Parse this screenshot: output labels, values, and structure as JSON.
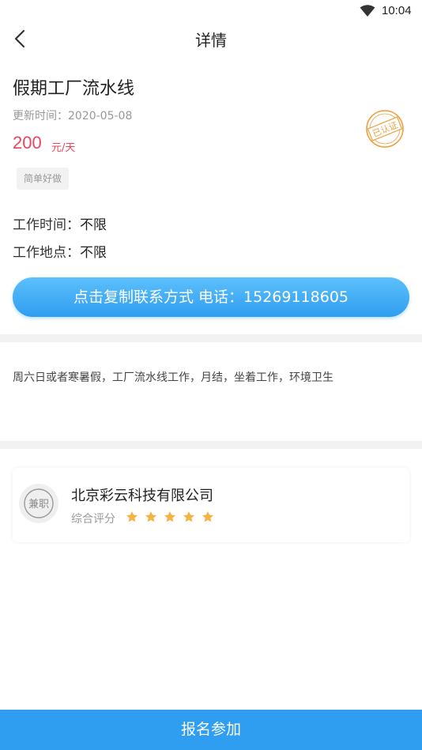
{
  "status_bar": {
    "time": "10:04"
  },
  "nav": {
    "title": "详情"
  },
  "job": {
    "title": "假期工厂流水线",
    "update_time": "更新时间：2020-05-08",
    "salary_amount": "200",
    "salary_unit": "元/天",
    "verified_stamp": "已认证",
    "tag": "简单好做",
    "work_time_label": "工作时间：",
    "work_time_value": "不限",
    "work_place_label": "工作地点：",
    "work_place_value": "不限"
  },
  "contact_button": {
    "label": "点击复制联系方式 电话：15269118605"
  },
  "description": "周六日或者寒暑假，工厂流水线工作，月结，坐着工作，环境卫生",
  "company": {
    "name": "北京彩云科技有限公司",
    "logo_text": "兼职",
    "rating_label": "综合评分",
    "rating": 5,
    "rating_max": 5
  },
  "bottom_bar": {
    "label": "报名参加"
  },
  "colors": {
    "accent": "#2f9df0",
    "salary": "#e8455e",
    "stamp": "#f0a040",
    "star": "#f5b342"
  },
  "icons": {
    "back": "chevron-left-icon",
    "wifi": "wifi-icon",
    "star": "star-icon",
    "stamp": "verified-stamp-icon"
  }
}
